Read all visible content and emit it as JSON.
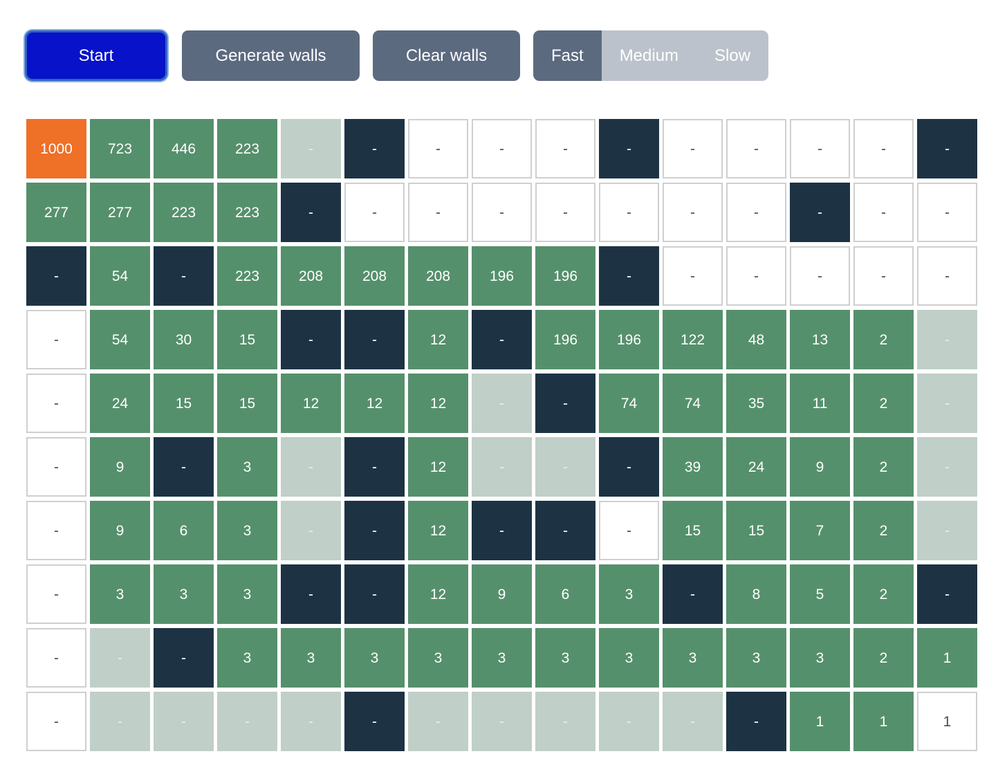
{
  "toolbar": {
    "start_label": "Start",
    "generate_walls_label": "Generate walls",
    "clear_walls_label": "Clear walls",
    "speeds": [
      {
        "label": "Fast",
        "active": true
      },
      {
        "label": "Medium",
        "active": false
      },
      {
        "label": "Slow",
        "active": false
      }
    ]
  },
  "colors": {
    "start": "#ef7027",
    "visited": "#55906c",
    "faded": "#c0cfc7",
    "wall": "#1d3344",
    "unvisited": "#ffffff",
    "unvisited_border": "#cfcfcf",
    "button_primary": "#0712c9",
    "button_gray": "#5c6a80",
    "button_gray_inactive": "#bcc2cb"
  },
  "grid": {
    "rows": 10,
    "cols": 15,
    "empty_label": "-",
    "cells": [
      [
        {
          "t": "start",
          "v": "1000"
        },
        {
          "t": "visited",
          "v": "723"
        },
        {
          "t": "visited",
          "v": "446"
        },
        {
          "t": "visited",
          "v": "223"
        },
        {
          "t": "faded",
          "v": "-"
        },
        {
          "t": "wall",
          "v": "-"
        },
        {
          "t": "unvisited",
          "v": "-"
        },
        {
          "t": "unvisited",
          "v": "-"
        },
        {
          "t": "unvisited",
          "v": "-"
        },
        {
          "t": "wall",
          "v": "-"
        },
        {
          "t": "unvisited",
          "v": "-"
        },
        {
          "t": "unvisited",
          "v": "-"
        },
        {
          "t": "unvisited",
          "v": "-"
        },
        {
          "t": "unvisited",
          "v": "-"
        },
        {
          "t": "wall",
          "v": "-"
        }
      ],
      [
        {
          "t": "visited",
          "v": "277"
        },
        {
          "t": "visited",
          "v": "277"
        },
        {
          "t": "visited",
          "v": "223"
        },
        {
          "t": "visited",
          "v": "223"
        },
        {
          "t": "wall",
          "v": "-"
        },
        {
          "t": "unvisited",
          "v": "-"
        },
        {
          "t": "unvisited",
          "v": "-"
        },
        {
          "t": "unvisited",
          "v": "-"
        },
        {
          "t": "unvisited",
          "v": "-"
        },
        {
          "t": "unvisited",
          "v": "-"
        },
        {
          "t": "unvisited",
          "v": "-"
        },
        {
          "t": "unvisited",
          "v": "-"
        },
        {
          "t": "wall",
          "v": "-"
        },
        {
          "t": "unvisited",
          "v": "-"
        },
        {
          "t": "unvisited",
          "v": "-"
        }
      ],
      [
        {
          "t": "wall",
          "v": "-"
        },
        {
          "t": "visited",
          "v": "54"
        },
        {
          "t": "wall",
          "v": "-"
        },
        {
          "t": "visited",
          "v": "223"
        },
        {
          "t": "visited",
          "v": "208"
        },
        {
          "t": "visited",
          "v": "208"
        },
        {
          "t": "visited",
          "v": "208"
        },
        {
          "t": "visited",
          "v": "196"
        },
        {
          "t": "visited",
          "v": "196"
        },
        {
          "t": "wall",
          "v": "-"
        },
        {
          "t": "unvisited",
          "v": "-"
        },
        {
          "t": "unvisited",
          "v": "-"
        },
        {
          "t": "unvisited",
          "v": "-"
        },
        {
          "t": "unvisited",
          "v": "-"
        },
        {
          "t": "unvisited",
          "v": "-"
        }
      ],
      [
        {
          "t": "unvisited",
          "v": "-"
        },
        {
          "t": "visited",
          "v": "54"
        },
        {
          "t": "visited",
          "v": "30"
        },
        {
          "t": "visited",
          "v": "15"
        },
        {
          "t": "wall",
          "v": "-"
        },
        {
          "t": "wall",
          "v": "-"
        },
        {
          "t": "visited",
          "v": "12"
        },
        {
          "t": "wall",
          "v": "-"
        },
        {
          "t": "visited",
          "v": "196"
        },
        {
          "t": "visited",
          "v": "196"
        },
        {
          "t": "visited",
          "v": "122"
        },
        {
          "t": "visited",
          "v": "48"
        },
        {
          "t": "visited",
          "v": "13"
        },
        {
          "t": "visited",
          "v": "2"
        },
        {
          "t": "faded",
          "v": "-"
        }
      ],
      [
        {
          "t": "unvisited",
          "v": "-"
        },
        {
          "t": "visited",
          "v": "24"
        },
        {
          "t": "visited",
          "v": "15"
        },
        {
          "t": "visited",
          "v": "15"
        },
        {
          "t": "visited",
          "v": "12"
        },
        {
          "t": "visited",
          "v": "12"
        },
        {
          "t": "visited",
          "v": "12"
        },
        {
          "t": "faded",
          "v": "-"
        },
        {
          "t": "wall",
          "v": "-"
        },
        {
          "t": "visited",
          "v": "74"
        },
        {
          "t": "visited",
          "v": "74"
        },
        {
          "t": "visited",
          "v": "35"
        },
        {
          "t": "visited",
          "v": "11"
        },
        {
          "t": "visited",
          "v": "2"
        },
        {
          "t": "faded",
          "v": "-"
        }
      ],
      [
        {
          "t": "unvisited",
          "v": "-"
        },
        {
          "t": "visited",
          "v": "9"
        },
        {
          "t": "wall",
          "v": "-"
        },
        {
          "t": "visited",
          "v": "3"
        },
        {
          "t": "faded",
          "v": "-"
        },
        {
          "t": "wall",
          "v": "-"
        },
        {
          "t": "visited",
          "v": "12"
        },
        {
          "t": "faded",
          "v": "-"
        },
        {
          "t": "faded",
          "v": "-"
        },
        {
          "t": "wall",
          "v": "-"
        },
        {
          "t": "visited",
          "v": "39"
        },
        {
          "t": "visited",
          "v": "24"
        },
        {
          "t": "visited",
          "v": "9"
        },
        {
          "t": "visited",
          "v": "2"
        },
        {
          "t": "faded",
          "v": "-"
        }
      ],
      [
        {
          "t": "unvisited",
          "v": "-"
        },
        {
          "t": "visited",
          "v": "9"
        },
        {
          "t": "visited",
          "v": "6"
        },
        {
          "t": "visited",
          "v": "3"
        },
        {
          "t": "faded",
          "v": "-"
        },
        {
          "t": "wall",
          "v": "-"
        },
        {
          "t": "visited",
          "v": "12"
        },
        {
          "t": "wall",
          "v": "-"
        },
        {
          "t": "wall",
          "v": "-"
        },
        {
          "t": "unvisited",
          "v": "-"
        },
        {
          "t": "visited",
          "v": "15"
        },
        {
          "t": "visited",
          "v": "15"
        },
        {
          "t": "visited",
          "v": "7"
        },
        {
          "t": "visited",
          "v": "2"
        },
        {
          "t": "faded",
          "v": "-"
        }
      ],
      [
        {
          "t": "unvisited",
          "v": "-"
        },
        {
          "t": "visited",
          "v": "3"
        },
        {
          "t": "visited",
          "v": "3"
        },
        {
          "t": "visited",
          "v": "3"
        },
        {
          "t": "wall",
          "v": "-"
        },
        {
          "t": "wall",
          "v": "-"
        },
        {
          "t": "visited",
          "v": "12"
        },
        {
          "t": "visited",
          "v": "9"
        },
        {
          "t": "visited",
          "v": "6"
        },
        {
          "t": "visited",
          "v": "3"
        },
        {
          "t": "wall",
          "v": "-"
        },
        {
          "t": "visited",
          "v": "8"
        },
        {
          "t": "visited",
          "v": "5"
        },
        {
          "t": "visited",
          "v": "2"
        },
        {
          "t": "wall",
          "v": "-"
        }
      ],
      [
        {
          "t": "unvisited",
          "v": "-"
        },
        {
          "t": "faded",
          "v": "-"
        },
        {
          "t": "wall",
          "v": "-"
        },
        {
          "t": "visited",
          "v": "3"
        },
        {
          "t": "visited",
          "v": "3"
        },
        {
          "t": "visited",
          "v": "3"
        },
        {
          "t": "visited",
          "v": "3"
        },
        {
          "t": "visited",
          "v": "3"
        },
        {
          "t": "visited",
          "v": "3"
        },
        {
          "t": "visited",
          "v": "3"
        },
        {
          "t": "visited",
          "v": "3"
        },
        {
          "t": "visited",
          "v": "3"
        },
        {
          "t": "visited",
          "v": "3"
        },
        {
          "t": "visited",
          "v": "2"
        },
        {
          "t": "visited",
          "v": "1"
        }
      ],
      [
        {
          "t": "unvisited",
          "v": "-"
        },
        {
          "t": "faded",
          "v": "-"
        },
        {
          "t": "faded",
          "v": "-"
        },
        {
          "t": "faded",
          "v": "-"
        },
        {
          "t": "faded",
          "v": "-"
        },
        {
          "t": "wall",
          "v": "-"
        },
        {
          "t": "faded",
          "v": "-"
        },
        {
          "t": "faded",
          "v": "-"
        },
        {
          "t": "faded",
          "v": "-"
        },
        {
          "t": "faded",
          "v": "-"
        },
        {
          "t": "faded",
          "v": "-"
        },
        {
          "t": "wall",
          "v": "-"
        },
        {
          "t": "visited",
          "v": "1"
        },
        {
          "t": "visited",
          "v": "1"
        },
        {
          "t": "unvisited",
          "v": "1"
        }
      ]
    ]
  }
}
